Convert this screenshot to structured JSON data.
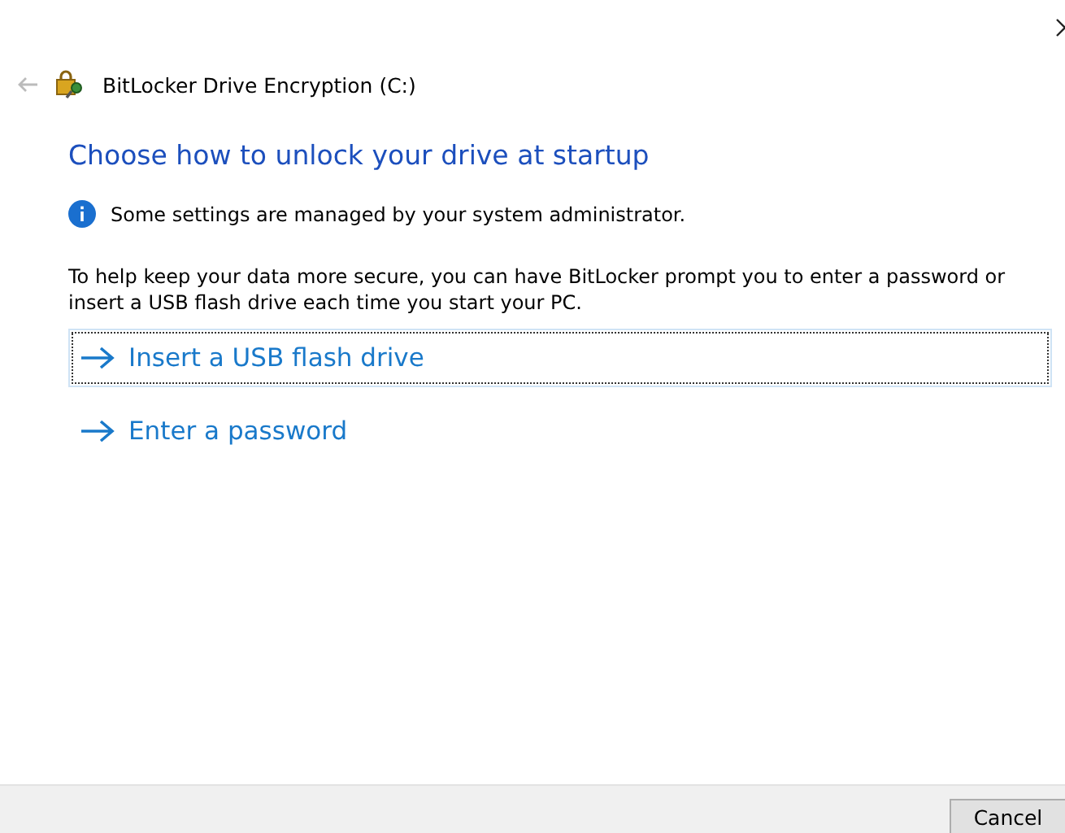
{
  "window": {
    "title": "BitLocker Drive Encryption (C:)"
  },
  "heading": "Choose how to unlock your drive at startup",
  "notice": "Some settings are managed by your system administrator.",
  "description": "To help keep your data more secure, you can have BitLocker prompt you to enter a password or insert a USB flash drive each time you start your PC.",
  "options": [
    {
      "label": "Insert a USB flash drive",
      "selected": true
    },
    {
      "label": "Enter a password",
      "selected": false
    }
  ],
  "buttons": [
    "Cancel"
  ]
}
